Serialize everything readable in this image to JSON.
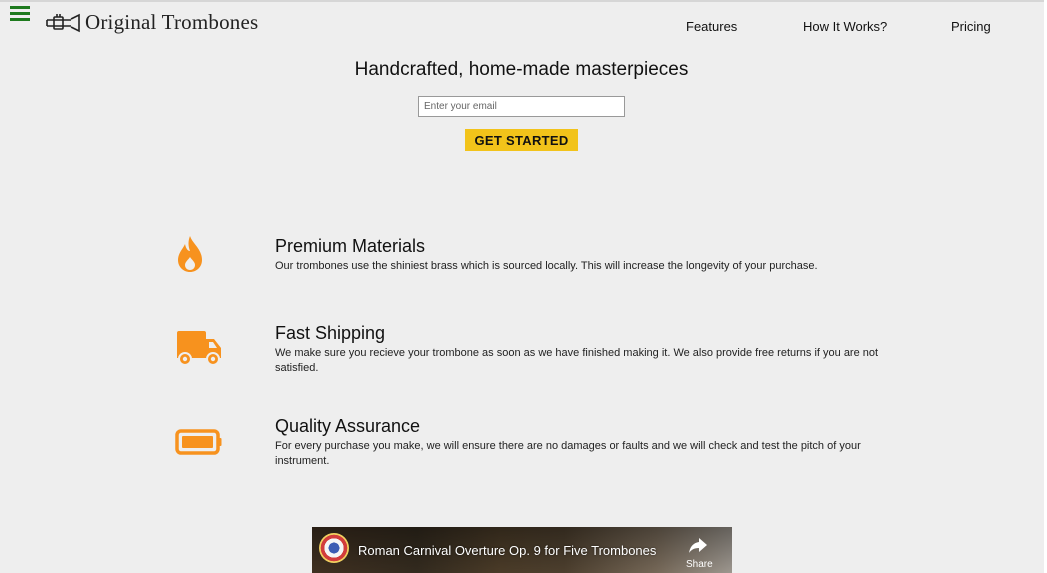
{
  "header": {
    "brand": "Original Trombones",
    "nav": [
      {
        "label": "Features"
      },
      {
        "label": "How It Works?"
      },
      {
        "label": "Pricing"
      }
    ]
  },
  "hero": {
    "title": "Handcrafted, home-made masterpieces",
    "email_placeholder": "Enter your email",
    "cta_label": "GET STARTED"
  },
  "features": [
    {
      "icon": "fire-icon",
      "title": "Premium Materials",
      "text": "Our trombones use the shiniest brass which is sourced locally. This will increase the longevity of your purchase."
    },
    {
      "icon": "truck-icon",
      "title": "Fast Shipping",
      "text": "We make sure you recieve your trombone as soon as we have finished making it. We also provide free returns if you are not satisfied."
    },
    {
      "icon": "battery-icon",
      "title": "Quality Assurance",
      "text": "For every purchase you make, we will ensure there are no damages or faults and we will check and test the pitch of your instrument."
    }
  ],
  "video": {
    "title": "Roman Carnival Overture Op. 9 for Five Trombones",
    "share_label": "Share"
  },
  "colors": {
    "accent_orange": "#f7921e",
    "cta_yellow": "#f2c31a",
    "hamburger_green": "#1e7a1e",
    "background": "#eeeeee"
  }
}
